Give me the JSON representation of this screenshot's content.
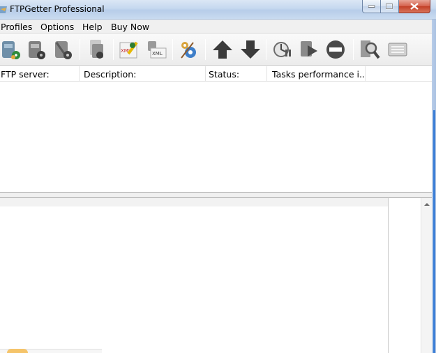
{
  "window": {
    "title": "FTPGetter Professional",
    "controls": {
      "minimize_icon": "minimize-icon",
      "maximize_icon": "maximize-icon",
      "close_icon": "close-icon"
    }
  },
  "menu": {
    "items": [
      "Profiles",
      "Options",
      "Help",
      "Buy Now"
    ]
  },
  "toolbar": {
    "buttons": [
      {
        "icon": "new-profile-icon"
      },
      {
        "icon": "edit-profile-icon"
      },
      {
        "icon": "delete-profile-icon"
      },
      {
        "icon": "copy-profile-icon"
      },
      {
        "icon": "export-xml-icon"
      },
      {
        "icon": "import-xml-icon"
      },
      {
        "icon": "settings-gears-icon"
      },
      {
        "icon": "move-up-icon"
      },
      {
        "icon": "move-down-icon"
      },
      {
        "icon": "scheduler-icon"
      },
      {
        "icon": "run-icon"
      },
      {
        "icon": "stop-icon"
      },
      {
        "icon": "search-log-icon"
      },
      {
        "icon": "console-icon"
      }
    ]
  },
  "list": {
    "columns": [
      "FTP server:",
      "Description:",
      "Status:",
      "Tasks performance i..."
    ]
  },
  "colors": {
    "accent": "#3c7fd6",
    "titlebar": "#c5d8ef",
    "close_button": "#c23f26"
  }
}
